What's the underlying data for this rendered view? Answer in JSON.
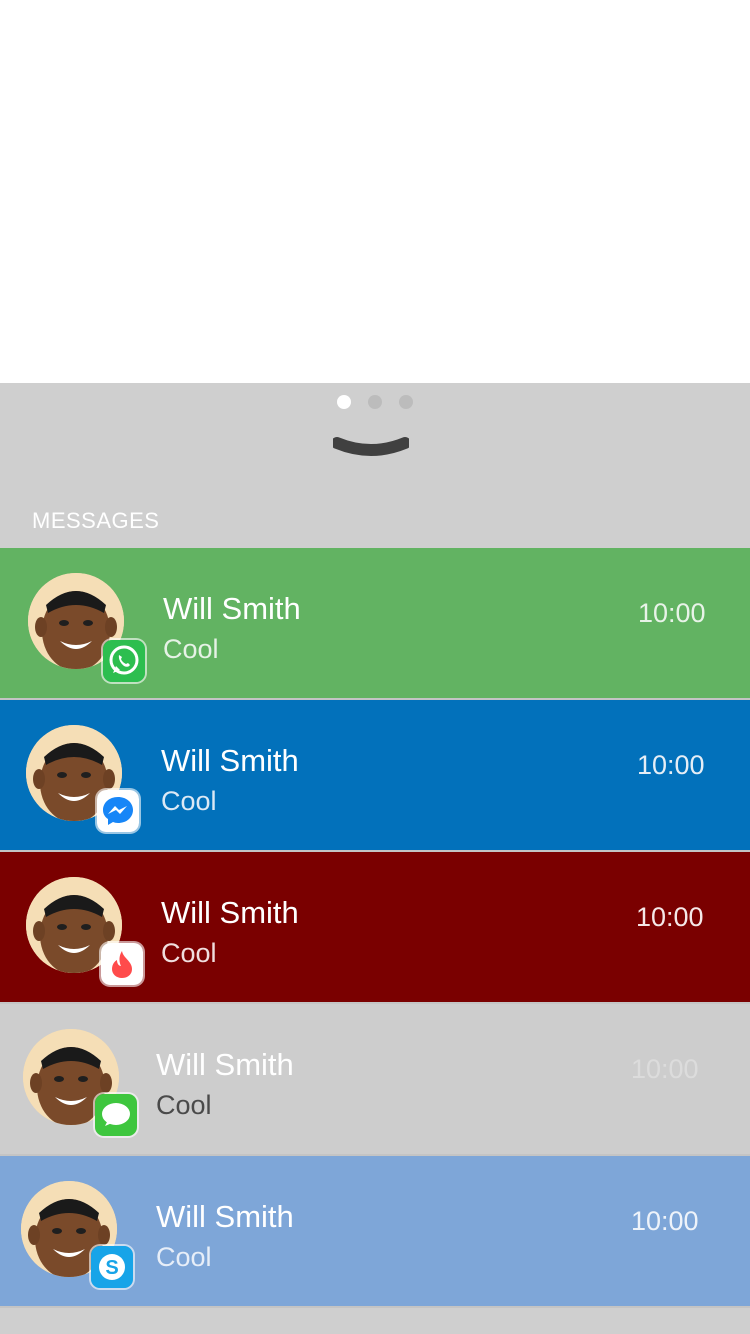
{
  "pager": {
    "dots": [
      {
        "name": "page-dot-1",
        "active": true
      },
      {
        "name": "page-dot-2",
        "active": false
      },
      {
        "name": "page-dot-3",
        "active": false
      }
    ]
  },
  "section_title": "MESSAGES",
  "messages": [
    {
      "name": "Will Smith",
      "preview": "Cool",
      "time": "10:00",
      "app_icon": "whatsapp-icon",
      "bg": "#62b362",
      "name_color": "#ffffff",
      "preview_color": "#e6f2e6",
      "time_color": "#e8f3e8"
    },
    {
      "name": "Will Smith",
      "preview": "Cool",
      "time": "10:00",
      "app_icon": "messenger-icon",
      "bg": "#0271bb",
      "name_color": "#ffffff",
      "preview_color": "#dce9f5",
      "time_color": "#e6eef6"
    },
    {
      "name": "Will Smith",
      "preview": "Cool",
      "time": "10:00",
      "app_icon": "tinder-icon",
      "bg": "#7a0000",
      "name_color": "#ffffff",
      "preview_color": "#f0dede",
      "time_color": "#f5e8e8"
    },
    {
      "name": "Will Smith",
      "preview": "Cool",
      "time": "10:00",
      "app_icon": "imessage-icon",
      "bg": "#cdcdcd",
      "name_color": "#ffffff",
      "preview_color": "#4a4a4a",
      "time_color": "#dcdcdc"
    },
    {
      "name": "Will Smith",
      "preview": "Cool",
      "time": "10:00",
      "app_icon": "skype-icon",
      "bg": "#7ea6d8",
      "name_color": "#ffffff",
      "preview_color": "#e7eef8",
      "time_color": "#eef3fa"
    }
  ],
  "colors": {
    "panel_bg": "#cfcfcf",
    "whatsapp": "#2dbe4f",
    "messenger": "#1786f7",
    "tinder": "#ff4b4b",
    "imessage": "#3ec63e",
    "skype": "#17a4e8"
  }
}
